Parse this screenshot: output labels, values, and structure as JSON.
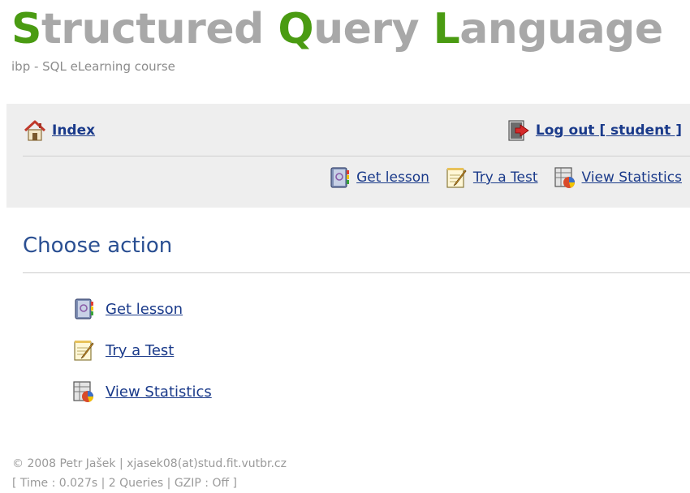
{
  "header": {
    "title_parts": [
      {
        "text": "S",
        "initial": true
      },
      {
        "text": "tructured ",
        "initial": false
      },
      {
        "text": "Q",
        "initial": true
      },
      {
        "text": "uery ",
        "initial": false
      },
      {
        "text": "L",
        "initial": true
      },
      {
        "text": "anguage",
        "initial": false
      }
    ],
    "subtitle": "ibp - SQL eLearning course",
    "title_color": "#a8a8a8",
    "initial_color": "#4a9b12"
  },
  "nav": {
    "index_label": "Index",
    "logout_label": "Log out [ student ]",
    "get_lesson_label": "Get lesson",
    "try_test_label": "Try a Test",
    "view_stats_label": "View Statistics",
    "icons": [
      "home-icon",
      "logout-icon",
      "book-icon",
      "pencil-note-icon",
      "statistics-icon"
    ]
  },
  "main": {
    "section_title": "Choose action",
    "actions": [
      {
        "label": "Get lesson",
        "icon": "book-icon"
      },
      {
        "label": "Try a Test",
        "icon": "pencil-note-icon"
      },
      {
        "label": "View Statistics",
        "icon": "statistics-icon"
      }
    ]
  },
  "footer": {
    "line1": "© 2008 Petr Jašek | xjasek08(at)stud.fit.vutbr.cz",
    "line2": "[ Time : 0.027s | 2 Queries | GZIP : Off ]"
  }
}
